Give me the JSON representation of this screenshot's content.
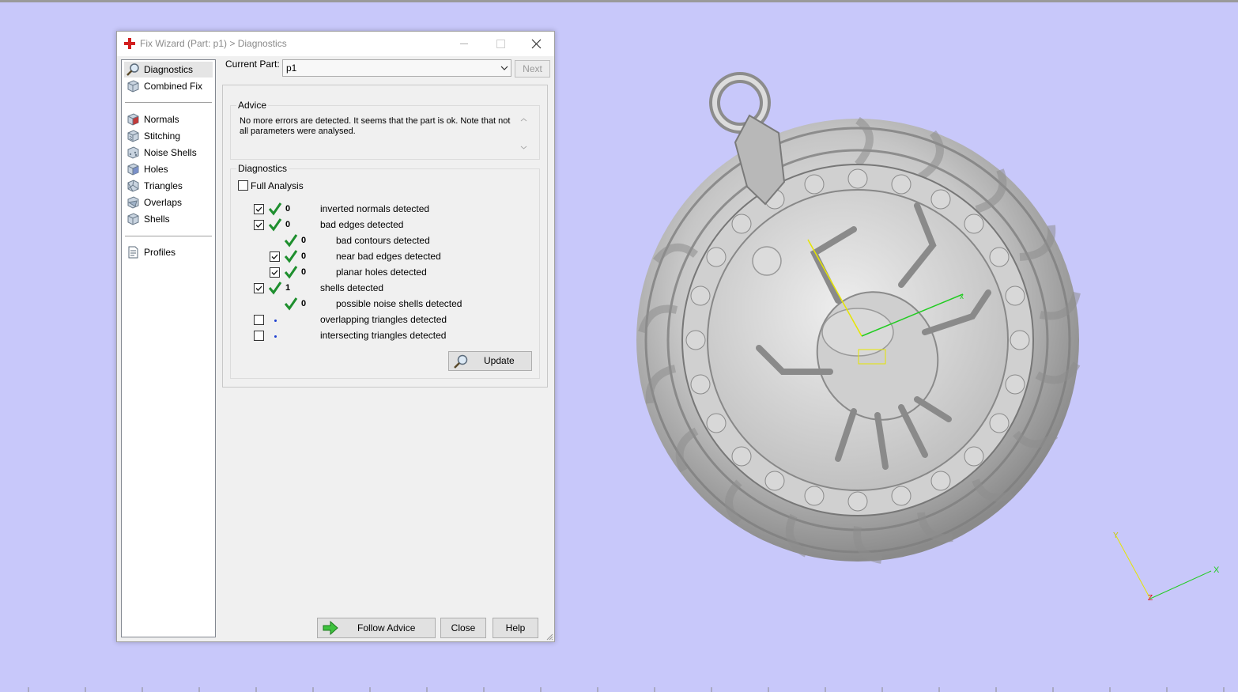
{
  "window": {
    "title": "Fix Wizard (Part: p1) > Diagnostics"
  },
  "nav": {
    "items": [
      {
        "label": "Diagnostics"
      },
      {
        "label": "Combined Fix"
      },
      {
        "label": "Normals"
      },
      {
        "label": "Stitching"
      },
      {
        "label": "Noise Shells"
      },
      {
        "label": "Holes"
      },
      {
        "label": "Triangles"
      },
      {
        "label": "Overlaps"
      },
      {
        "label": "Shells"
      },
      {
        "label": "Profiles"
      }
    ]
  },
  "part": {
    "label": "Current Part:",
    "value": "p1",
    "next_label": "Next"
  },
  "advice": {
    "title": "Advice",
    "text": "No more errors are detected. It seems that the part is ok. Note that not all parameters were analysed."
  },
  "diagnostics": {
    "title": "Diagnostics",
    "full_analysis_label": "Full Analysis",
    "rows": [
      {
        "value": "0",
        "label": "inverted normals detected"
      },
      {
        "value": "0",
        "label": "bad edges detected"
      },
      {
        "value": "0",
        "label": "bad contours detected"
      },
      {
        "value": "0",
        "label": "near bad edges detected"
      },
      {
        "value": "0",
        "label": "planar holes detected"
      },
      {
        "value": "1",
        "label": "shells detected"
      },
      {
        "value": "0",
        "label": "possible noise shells detected"
      },
      {
        "value": "",
        "label": "overlapping triangles detected"
      },
      {
        "value": "",
        "label": "intersecting triangles detected"
      }
    ],
    "update_label": "Update"
  },
  "footer": {
    "follow_advice_label": "Follow Advice",
    "close_label": "Close",
    "help_label": "Help"
  },
  "viewport": {
    "background": "#c8c8fa",
    "axes": {
      "x_label": "X",
      "y_label": "Y",
      "z_label": "Z"
    }
  }
}
